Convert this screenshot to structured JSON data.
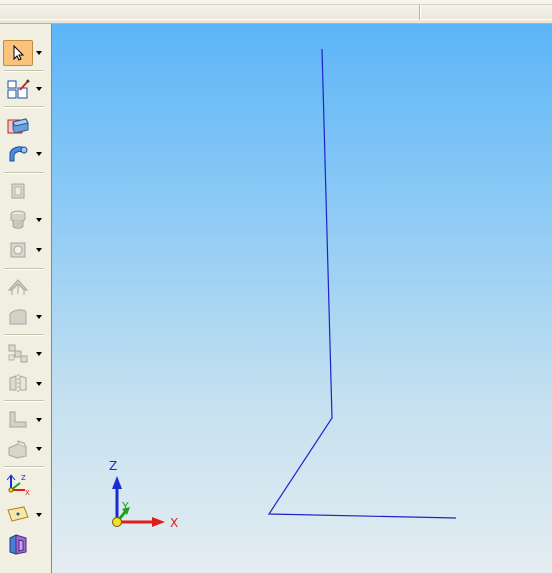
{
  "colors": {
    "viewport_top": "#5cb5f8",
    "viewport_bottom": "#e4edf1",
    "sketch_line": "#1f22c8",
    "axis_x": "#e31b1b",
    "axis_y": "#1aa31a",
    "axis_z": "#1a2bd6",
    "active_tool": "#f9c37d"
  },
  "toolbar": {
    "tools": [
      {
        "icon": "select-arrow-icon",
        "active": true,
        "dropdown": true
      },
      {
        "icon": "sketch-edit-icon",
        "active": false,
        "dropdown": true
      },
      {
        "icon": "extrude-box-icon",
        "active": false,
        "dropdown": false
      },
      {
        "icon": "revolve-icon",
        "active": false,
        "dropdown": true
      },
      {
        "icon": "face-icon",
        "active": false,
        "dropdown": false
      },
      {
        "icon": "cylinder-stack-icon",
        "active": false,
        "dropdown": true
      },
      {
        "icon": "hole-icon",
        "active": false,
        "dropdown": true
      },
      {
        "icon": "shell-icon",
        "active": false,
        "dropdown": false
      },
      {
        "icon": "surface-icon",
        "active": false,
        "dropdown": true
      },
      {
        "icon": "pattern-icon",
        "active": false,
        "dropdown": true
      },
      {
        "icon": "mirror-icon",
        "active": false,
        "dropdown": true
      },
      {
        "icon": "bracket-icon",
        "active": false,
        "dropdown": true
      },
      {
        "icon": "part-icon",
        "active": false,
        "dropdown": true
      },
      {
        "icon": "coordinate-system-icon",
        "active": false,
        "dropdown": true
      },
      {
        "icon": "plane-icon",
        "active": false,
        "dropdown": true
      },
      {
        "icon": "view-icon",
        "active": false,
        "dropdown": false
      }
    ]
  },
  "viewport": {
    "triad": {
      "x_label": "X",
      "y_label": "Y",
      "z_label": "Z"
    }
  }
}
